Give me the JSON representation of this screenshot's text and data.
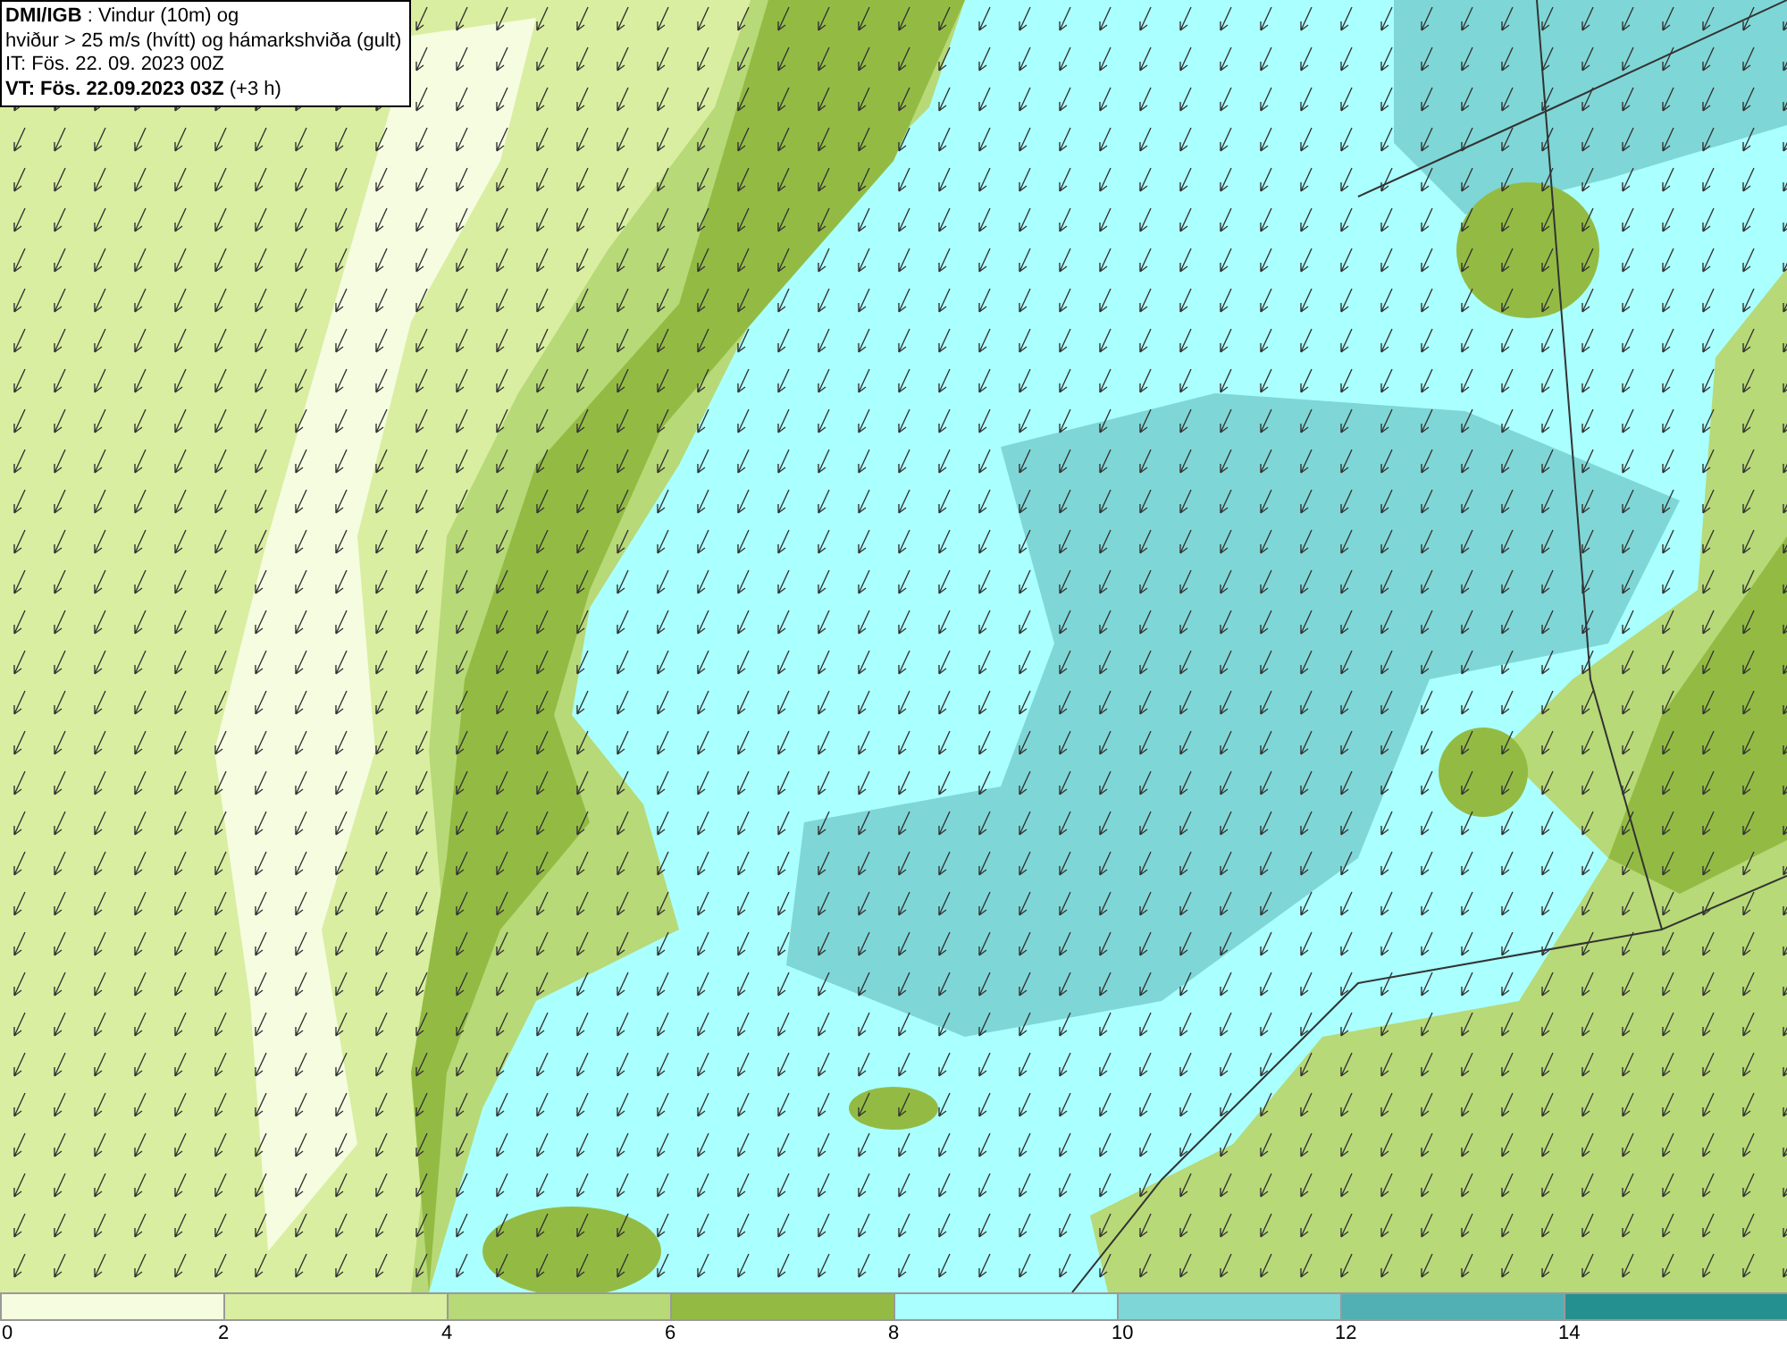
{
  "legend": {
    "lines": [
      "**DMI/IGB** : Vindur (10m) og",
      "hviður > 25 m/s (hvítt) og hámarkshviða (gult)",
      "IT: Fös. 22. 09. 2023 00Z",
      "**VT: Fös. 22.09.2023 03Z** (+3 h)"
    ]
  },
  "colorbar": {
    "segments": [
      {
        "color": "#f5fce0",
        "label": "0"
      },
      {
        "color": "#d9eea0",
        "label": "2"
      },
      {
        "color": "#b7d977",
        "label": "4"
      },
      {
        "color": "#93bb44",
        "label": "6"
      },
      {
        "color": "#aaffff",
        "label": "8"
      },
      {
        "color": "#7fd6d6",
        "label": "10"
      },
      {
        "color": "#50b0b4",
        "label": "12"
      },
      {
        "color": "#259090",
        "label": "14"
      }
    ]
  }
}
